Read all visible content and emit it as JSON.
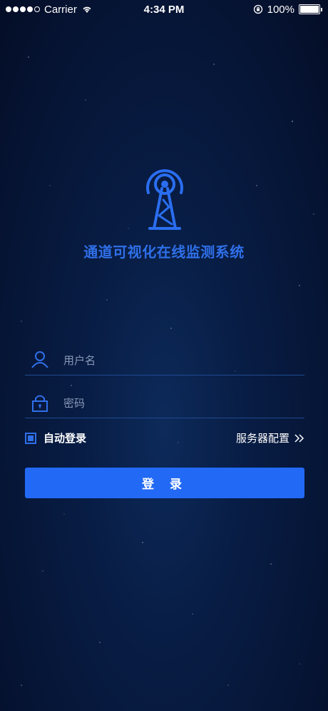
{
  "status_bar": {
    "carrier": "Carrier",
    "time": "4:34 PM",
    "battery": "100%",
    "signal_dots_filled": 4,
    "signal_dots_total": 5
  },
  "app": {
    "title": "通道可视化在线监测系统",
    "logo_icon": "radio-tower-icon"
  },
  "form": {
    "username": {
      "placeholder": "用户名",
      "value": "",
      "icon": "user-icon"
    },
    "password": {
      "placeholder": "密码",
      "value": "",
      "icon": "lock-icon"
    },
    "auto_login": {
      "label": "自动登录",
      "checked": true
    },
    "server_config": {
      "label": "服务器配置",
      "icon": "double-chevron-right-icon"
    },
    "login_button": "登 录"
  },
  "colors": {
    "accent": "#2f6fe8",
    "button": "#2269f5",
    "background": "#061536"
  }
}
